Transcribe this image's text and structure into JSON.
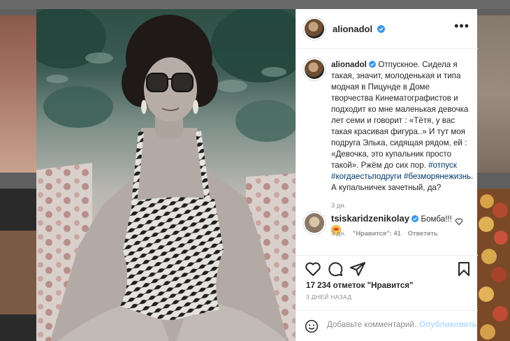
{
  "post": {
    "author": "alionadol",
    "caption_head": "Отпускное.",
    "caption_body": "Сидела я такая, значит, молоденькая и типа модная в Пицунде в Доме творчества Кинематографистов и подходит ко мне маленькая девочка лет семи и говорит : «Тётя, у вас такая красивая фигура..» И тут моя подруга Элька, сидящая рядом, ей : «Девочка, это купальник просто такой». Ржём до сих пор.",
    "tags": [
      "#отпуск",
      "#когдаестьподруги",
      "#безморянежизнь"
    ],
    "caption_tail": ". А купальничек зачетный, да?",
    "caption_time": "3 дн.",
    "likes": "17 234 отметок \"Нравится\"",
    "date": "3 ДНЕЙ НАЗАД"
  },
  "comment": {
    "author": "tsiskaridzenikolay",
    "text": "Бомба!!!",
    "emoji": "heart-eyes-emoji",
    "time": "3 дн.",
    "likes": "\"Нравится\": 41",
    "reply": "Ответить"
  },
  "comment_box": {
    "placeholder": "Добавьте комментарий...",
    "publish": "Опубликовать"
  },
  "colors": {
    "verified": "#3897f0",
    "link": "#00376b",
    "muted": "#8e8e8e",
    "publish_disabled": "#b3dbff"
  },
  "icons": [
    "more-icon",
    "heart-icon",
    "comment-icon",
    "share-icon",
    "bookmark-icon",
    "smile-icon",
    "verified-icon"
  ]
}
